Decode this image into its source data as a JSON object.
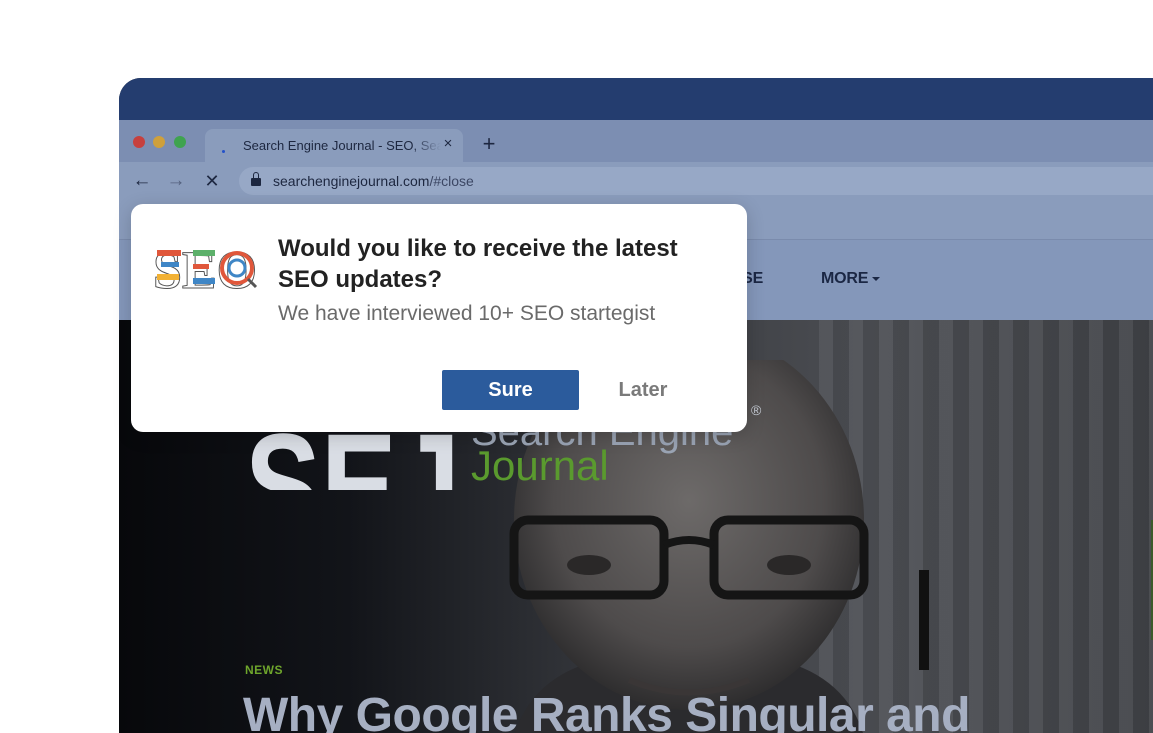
{
  "browser": {
    "tab": {
      "title": "Search Engine Journal - SEO, Search Marketing",
      "close_icon": "×"
    },
    "new_tab_icon": "+",
    "nav": {
      "back_icon": "←",
      "forward_icon": "→",
      "stop_icon": "✕"
    },
    "url": {
      "host": "searchenginejournal.com",
      "path": "/#close"
    }
  },
  "site": {
    "nav_items": [
      {
        "label": "RTISE"
      },
      {
        "label": "MORE"
      }
    ],
    "logo": {
      "mark": "SEJ",
      "word1": "Search Engine",
      "word2": "Journal",
      "registered": "®"
    },
    "hero": {
      "category": "NEWS",
      "headline": "Why Google Ranks Singular and"
    }
  },
  "dialog": {
    "logo_text": "SEO",
    "title": "Would you like to receive the latest SEO updates?",
    "subtitle": "We have interviewed 10+ SEO startegist",
    "primary_button": "Sure",
    "secondary_button": "Later"
  },
  "colors": {
    "window_frame": "#243d6f",
    "primary_button": "#2b5b9c",
    "news_label": "#6ea52c",
    "logo_green": "#5a9a2e"
  }
}
